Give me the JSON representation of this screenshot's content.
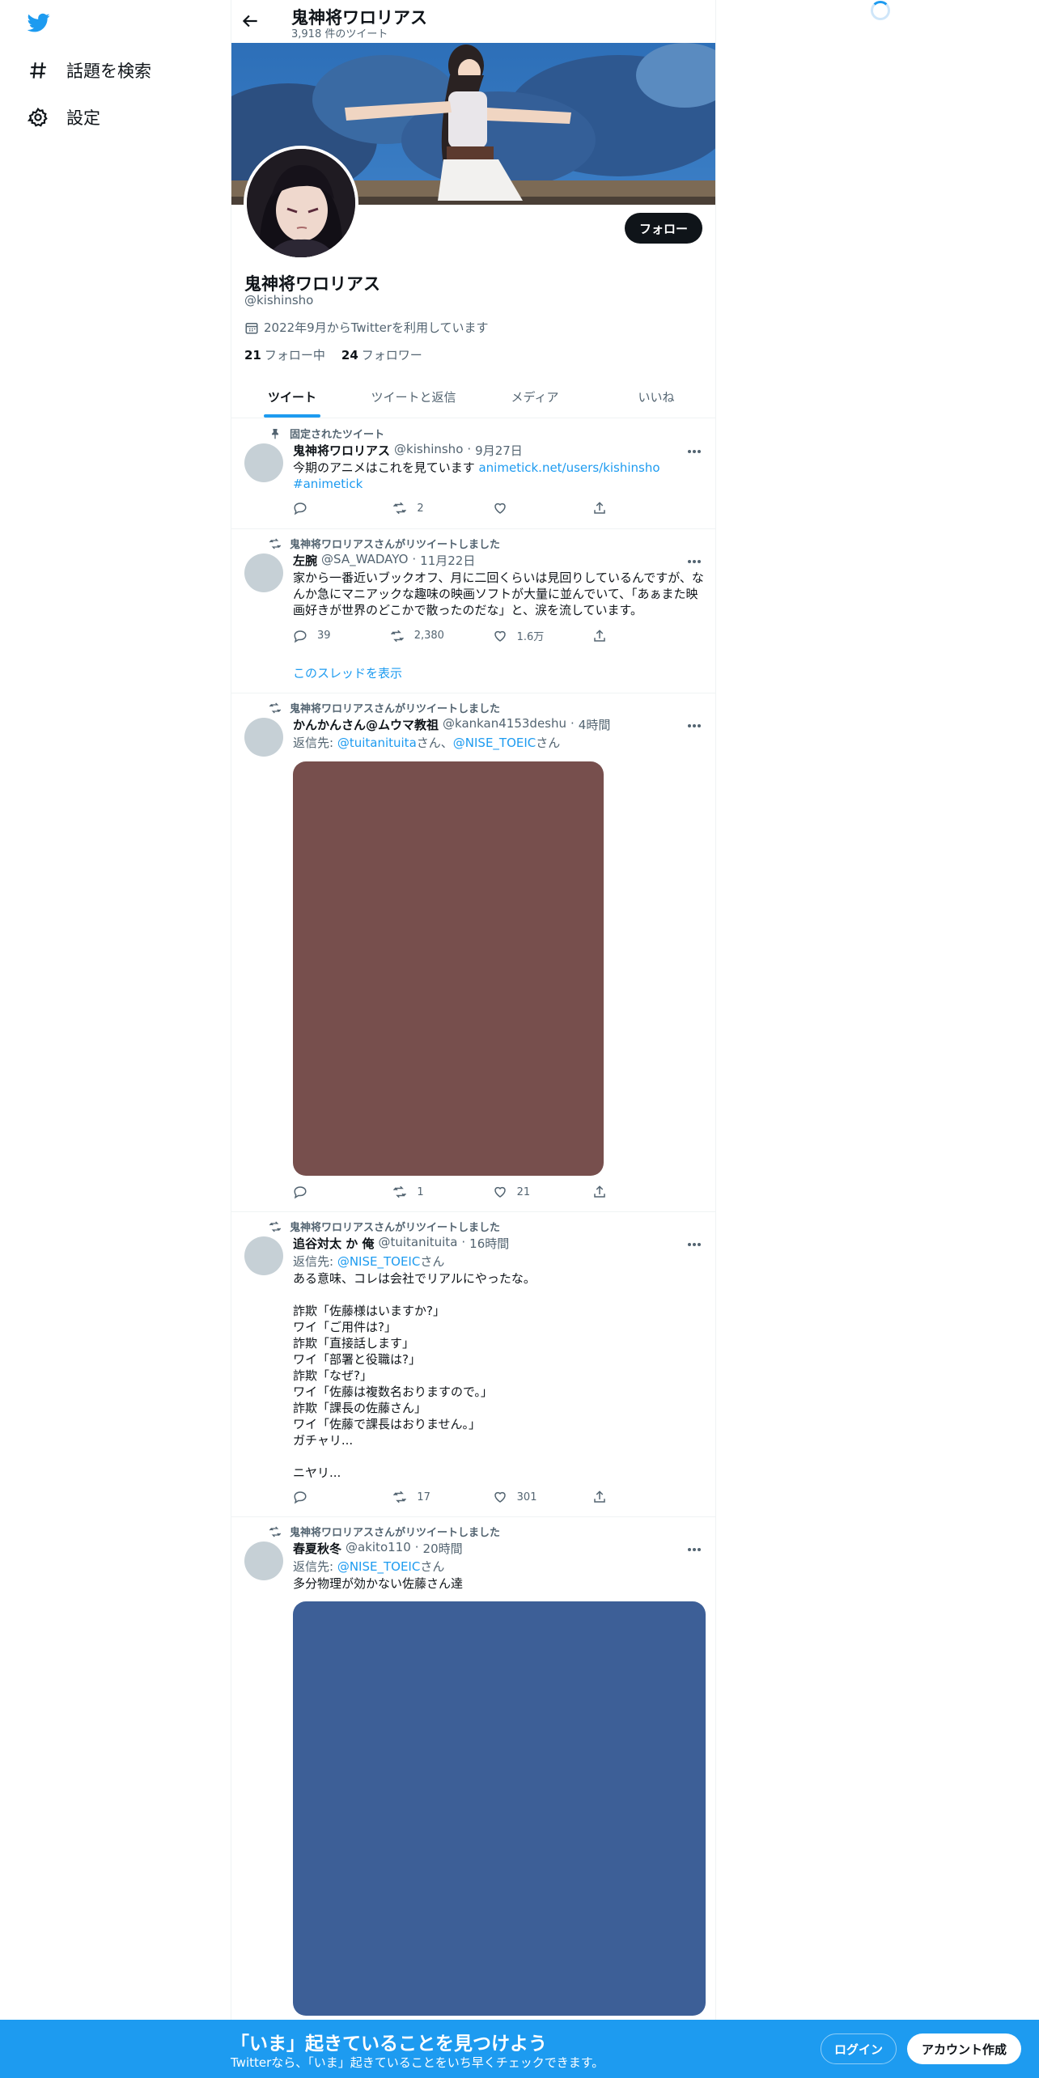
{
  "sidebar": {
    "items": [
      {
        "label": "話題を検索",
        "icon": "hashtag-icon"
      },
      {
        "label": "設定",
        "icon": "gear-icon"
      }
    ]
  },
  "header": {
    "name": "鬼神将ワロリアス",
    "tweet_count": "3,918 件のツイート"
  },
  "profile": {
    "name": "鬼神将ワロリアス",
    "handle": "@kishinsho",
    "joined": "2022年9月からTwitterを利用しています",
    "following_count": "21",
    "following_label": "フォロー中",
    "followers_count": "24",
    "followers_label": "フォロワー",
    "follow_button": "フォロー"
  },
  "tabs": [
    "ツイート",
    "ツイートと返信",
    "メディア",
    "いいね"
  ],
  "tweets": [
    {
      "context": "固定されたツイート",
      "name": "鬼神将ワロリアス",
      "handle": "@kishinsho",
      "time": "9月27日",
      "text": "今期のアニメはこれを見ています ",
      "link1": "animetick.net/users/kishinsho",
      "link2": "#animetick",
      "replies": "",
      "retweets": "2",
      "likes": ""
    },
    {
      "context": "鬼神将ワロリアスさんがリツイートしました",
      "name": "左腕",
      "handle": "@SA_WADAYO",
      "time": "11月22日",
      "text": "家から一番近いブックオフ、月に二回くらいは見回りしているんですが、なんか急にマニアックな趣味の映画ソフトが大量に並んでいて、「あぁまた映画好きが世界のどこかで散ったのだな」と、涙を流しています。",
      "replies": "39",
      "retweets": "2,380",
      "likes": "1.6万",
      "thread": "このスレッドを表示"
    },
    {
      "context": "鬼神将ワロリアスさんがリツイートしました",
      "name": "かんかんさん@ムウマ教祖",
      "handle": "@kankan4153deshu",
      "time": "4時間",
      "reply_prefix": "返信先: ",
      "reply_user1": "@tuitanituita",
      "reply_mid": "さん、",
      "reply_user2": "@NISE_TOEIC",
      "reply_suffix": "さん",
      "media_color": "#774f4d",
      "replies": "",
      "retweets": "1",
      "likes": "21"
    },
    {
      "context": "鬼神将ワロリアスさんがリツイートしました",
      "name": "追谷対太 か 俺",
      "handle": "@tuitanituita",
      "time": "16時間",
      "reply_prefix": "返信先: ",
      "reply_user1": "@NISE_TOEIC",
      "reply_suffix": "さん",
      "text": "ある意味、コレは会社でリアルにやったな。\n\n詐欺「佐藤様はいますか?」\nワイ「ご用件は?」\n詐欺「直接話します」\nワイ「部署と役職は?」\n詐欺「なぜ?」\nワイ「佐藤は複数名おりますので。」\n詐欺「課長の佐藤さん」\nワイ「佐藤で課長はおりません。」\nガチャリ...\n\nニヤリ...",
      "replies": "",
      "retweets": "17",
      "likes": "301"
    },
    {
      "context": "鬼神将ワロリアスさんがリツイートしました",
      "name": "春夏秋冬",
      "handle": "@akito110",
      "time": "20時間",
      "reply_prefix": "返信先: ",
      "reply_user1": "@NISE_TOEIC",
      "reply_suffix": "さん",
      "text": "多分物理が効かない佐藤さん達",
      "media_color": "#3d5f97"
    }
  ],
  "bottom_bar": {
    "title": "「いま」起きていることを見つけよう",
    "subtitle": "Twitterなら、「いま」起きていることをいち早くチェックできます。",
    "login": "ログイン",
    "signup": "アカウント作成"
  }
}
